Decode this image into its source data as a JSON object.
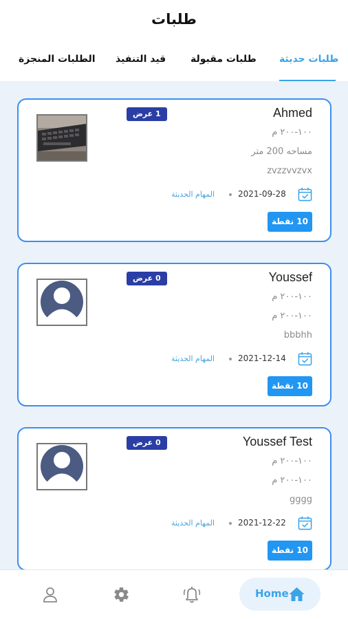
{
  "header": {
    "title": "طلبات"
  },
  "tabs": [
    {
      "label": "طلبات حديثة",
      "active": true
    },
    {
      "label": "طلبات مقبولة",
      "active": false
    },
    {
      "label": "قيد التنفيذ",
      "active": false
    },
    {
      "label": "الطلبات المنجزة",
      "active": false
    }
  ],
  "cards": [
    {
      "name": "Ahmed",
      "offers": "1 عرض",
      "line1": "١٠٠-٢٠٠ م",
      "line2": "مساحه 200 متر",
      "line3": "zvzzvvzvx",
      "date": "2021-09-28",
      "task": "المهام الحديثة",
      "points": "10 نقطة",
      "thumb": "photo"
    },
    {
      "name": "Youssef",
      "offers": "0 عرض",
      "line1": "١٠٠-٢٠٠ م",
      "line2": "١٠٠-٢٠٠ م",
      "line3": "bbbhh",
      "date": "2021-12-14",
      "task": "المهام الحديثة",
      "points": "10 نقطة",
      "thumb": "avatar"
    },
    {
      "name": "Youssef Test",
      "offers": "0 عرض",
      "line1": "١٠٠-٢٠٠ م",
      "line2": "١٠٠-٢٠٠ م",
      "line3": "gggg",
      "date": "2021-12-22",
      "task": "المهام الحديثة",
      "points": "10 نقطة",
      "thumb": "avatar"
    }
  ],
  "bottom_nav": {
    "home_label": "Home",
    "items": [
      "profile-icon",
      "settings-icon",
      "notifications-icon",
      "home-icon"
    ]
  },
  "colors": {
    "accent": "#3ba3e8",
    "card_border": "#3b8ef0",
    "badge": "#2a3ea5",
    "points": "#2196f3",
    "background": "#ebf2f9"
  }
}
